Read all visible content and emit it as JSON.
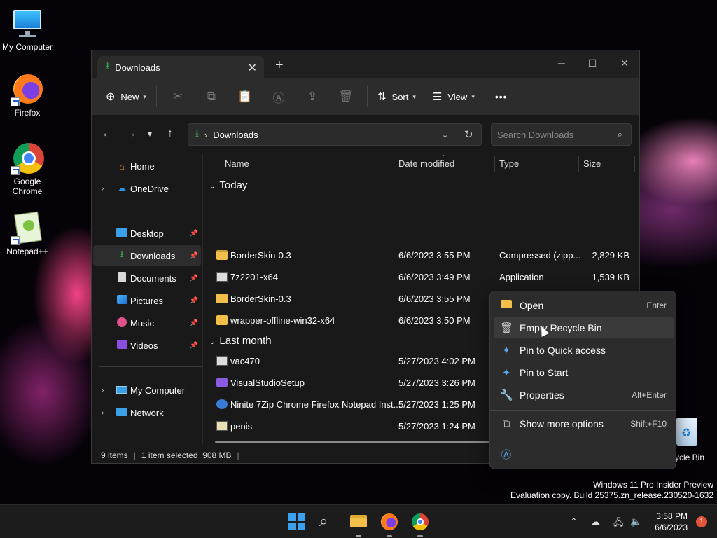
{
  "desktop": {
    "icons": [
      {
        "label": "My Computer"
      },
      {
        "label": "Firefox"
      },
      {
        "label": "Google Chrome"
      },
      {
        "label": "Notepad++"
      }
    ],
    "recycle_bin_label": "ycle Bin"
  },
  "window": {
    "tab_title": "Downloads",
    "new_tab": "+",
    "controls": {
      "minimize": "─",
      "maximize": "☐",
      "close": "✕"
    },
    "toolbar": {
      "new_label": "New",
      "sort_label": "Sort",
      "view_label": "View",
      "more_label": "•••"
    },
    "address": {
      "separator": "›",
      "location": "Downloads"
    },
    "search": {
      "placeholder": "Search Downloads"
    },
    "nav": {
      "items": [
        {
          "label": "Home"
        },
        {
          "label": "OneDrive"
        },
        {
          "label": "Desktop"
        },
        {
          "label": "Downloads"
        },
        {
          "label": "Documents"
        },
        {
          "label": "Pictures"
        },
        {
          "label": "Music"
        },
        {
          "label": "Videos"
        },
        {
          "label": "My Computer"
        },
        {
          "label": "Network"
        }
      ]
    },
    "columns": {
      "name": "Name",
      "date": "Date modified",
      "type": "Type",
      "size": "Size"
    },
    "groups": [
      {
        "label": "Today",
        "files": [
          {
            "name": "BorderSkin-0.3",
            "date": "6/6/2023 3:55 PM",
            "type": "Compressed (zipp...",
            "size": "2,829 KB"
          },
          {
            "name": "7z2201-x64",
            "date": "6/6/2023 3:49 PM",
            "type": "Application",
            "size": "1,539 KB"
          },
          {
            "name": "BorderSkin-0.3",
            "date": "6/6/2023 3:55 PM",
            "type": "File folder",
            "size": ""
          },
          {
            "name": "wrapper-offline-win32-x64",
            "date": "6/6/2023 3:50 PM",
            "type": "File folder",
            "size": ""
          }
        ]
      },
      {
        "label": "Last month",
        "files": [
          {
            "name": "vac470",
            "date": "5/27/2023 4:02 PM",
            "type": "",
            "size": ""
          },
          {
            "name": "VisualStudioSetup",
            "date": "5/27/2023 3:26 PM",
            "type": "",
            "size": ""
          },
          {
            "name": "Ninite 7Zip Chrome Firefox Notepad Inst...",
            "date": "5/27/2023 1:25 PM",
            "type": "",
            "size": ""
          },
          {
            "name": "penis",
            "date": "5/27/2023 1:24 PM",
            "type": "",
            "size": ""
          }
        ]
      }
    ],
    "status": {
      "items": "9 items",
      "selected": "1 item selected  908 MB",
      "sep": "|"
    }
  },
  "context_menu": {
    "items": [
      {
        "label": "Open",
        "shortcut": "Enter"
      },
      {
        "label": "Empty Recycle Bin",
        "shortcut": ""
      },
      {
        "label": "Pin to Quick access",
        "shortcut": ""
      },
      {
        "label": "Pin to Start",
        "shortcut": ""
      },
      {
        "label": "Properties",
        "shortcut": "Alt+Enter"
      },
      {
        "label": "Show more options",
        "shortcut": "Shift+F10"
      }
    ]
  },
  "watermark": {
    "line1": "Windows 11 Pro Insider Preview",
    "line2": "Evaluation copy. Build 25375.zn_release.230520-1632"
  },
  "taskbar": {
    "time": "3:58 PM",
    "date": "6/6/2023",
    "notification_count": "1"
  },
  "colors": {
    "accent": "#0078d4",
    "folder": "#f2c04a",
    "download_green": "#2ea84f"
  }
}
